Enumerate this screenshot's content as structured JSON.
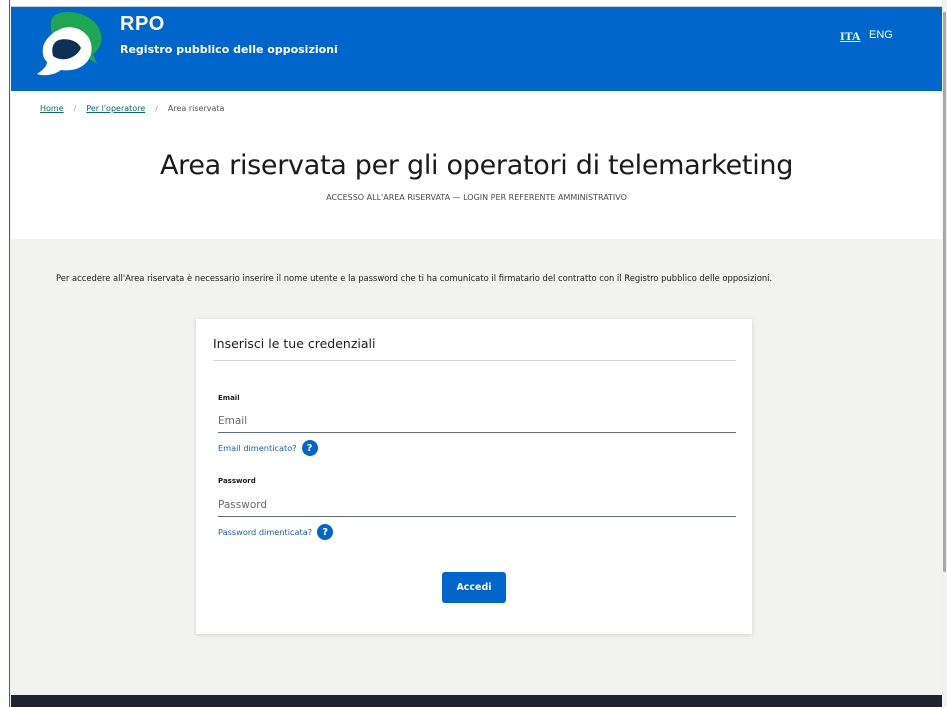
{
  "header": {
    "brand_title": "RPO",
    "brand_subtitle": "Registro pubblico delle opposizioni",
    "lang_active": "ITA",
    "lang_other": "ENG",
    "logo_icon": "speech-bubbles-logo-icon",
    "colors": {
      "primary": "#0066cc",
      "logo_green": "#1fa554",
      "logo_navy": "#0e2f56"
    }
  },
  "breadcrumb": {
    "items": [
      "Home",
      "Per l'operatore",
      "Area riservata"
    ],
    "separator": "/"
  },
  "page": {
    "title": "Area riservata per gli operatori di telemarketing",
    "subtitle": "ACCESSO ALL'AREA RISERVATA — LOGIN PER REFERENTE AMMINISTRATIVO",
    "intro": "Per accedere all'Area riservata è necessario inserire il nome utente e la password che ti ha comunicato il firmatario del contratto con il Registro pubblico delle opposizioni."
  },
  "login": {
    "title": "Inserisci le tue credenziali",
    "email_label": "Email",
    "email_placeholder": "Email",
    "email_help": "Email dimenticato?",
    "password_label": "Password",
    "password_placeholder": "Password",
    "password_help": "Password dimenticata?",
    "help_icon_glyph": "?",
    "submit_label": "Accedi"
  }
}
